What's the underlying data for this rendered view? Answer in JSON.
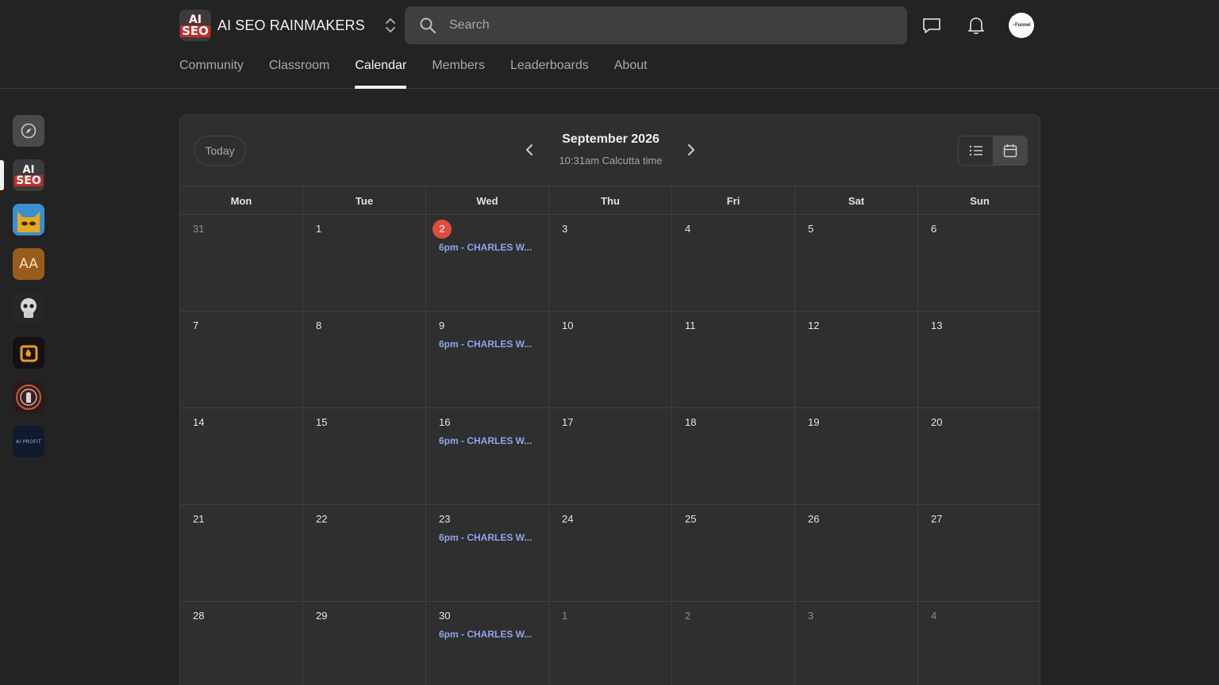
{
  "brand": {
    "name": "AI SEO RAINMAKERS",
    "logo_line1": "AI",
    "logo_line2": "SEO"
  },
  "search": {
    "placeholder": "Search"
  },
  "avatar": {
    "text_prefix": "●",
    "text": "Funnel"
  },
  "nav": {
    "tabs": [
      {
        "label": "Community"
      },
      {
        "label": "Classroom"
      },
      {
        "label": "Calendar",
        "active": true
      },
      {
        "label": "Members"
      },
      {
        "label": "Leaderboards"
      },
      {
        "label": "About"
      }
    ]
  },
  "rail": {
    "seo_line1": "AI",
    "seo_line2": "SEO",
    "aa_label": "AA",
    "profit_label": "AI PROFIT"
  },
  "calendar": {
    "today_label": "Today",
    "month_title": "September 2026",
    "tz_line": "10:31am Calcutta time",
    "weekdays": [
      "Mon",
      "Tue",
      "Wed",
      "Thu",
      "Fri",
      "Sat",
      "Sun"
    ],
    "weeks": [
      [
        {
          "n": "31",
          "muted": true
        },
        {
          "n": "1"
        },
        {
          "n": "2",
          "today": true,
          "event": "6pm - CHARLES W..."
        },
        {
          "n": "3"
        },
        {
          "n": "4"
        },
        {
          "n": "5"
        },
        {
          "n": "6"
        }
      ],
      [
        {
          "n": "7"
        },
        {
          "n": "8"
        },
        {
          "n": "9",
          "event": "6pm - CHARLES W..."
        },
        {
          "n": "10"
        },
        {
          "n": "11"
        },
        {
          "n": "12"
        },
        {
          "n": "13"
        }
      ],
      [
        {
          "n": "14"
        },
        {
          "n": "15"
        },
        {
          "n": "16",
          "event": "6pm - CHARLES W..."
        },
        {
          "n": "17"
        },
        {
          "n": "18"
        },
        {
          "n": "19"
        },
        {
          "n": "20"
        }
      ],
      [
        {
          "n": "21"
        },
        {
          "n": "22"
        },
        {
          "n": "23",
          "event": "6pm - CHARLES W..."
        },
        {
          "n": "24"
        },
        {
          "n": "25"
        },
        {
          "n": "26"
        },
        {
          "n": "27"
        }
      ],
      [
        {
          "n": "28"
        },
        {
          "n": "29"
        },
        {
          "n": "30",
          "event": "6pm - CHARLES W..."
        },
        {
          "n": "1",
          "muted": true
        },
        {
          "n": "2",
          "muted": true
        },
        {
          "n": "3",
          "muted": true
        },
        {
          "n": "4",
          "muted": true
        }
      ]
    ]
  },
  "colors": {
    "today_badge": "#e04c3c",
    "event_text": "#8fa3ea",
    "brand_red": "#c92a2a"
  }
}
